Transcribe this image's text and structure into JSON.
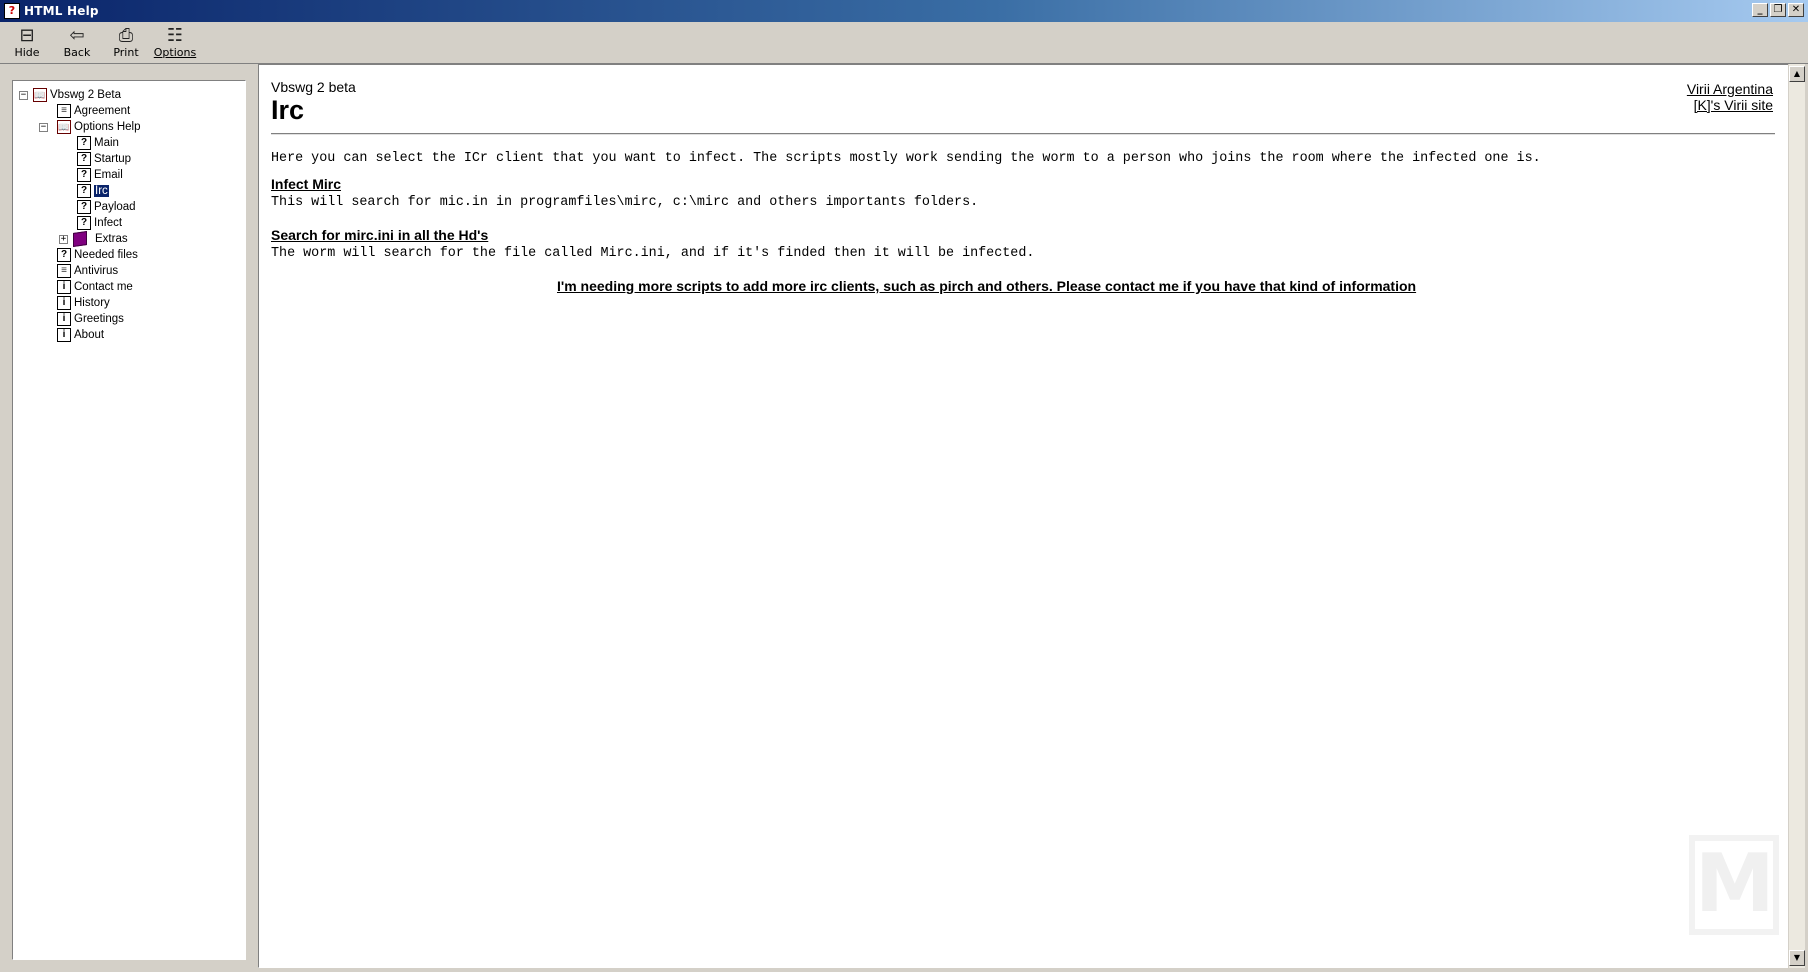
{
  "window": {
    "title": "HTML Help",
    "icon": "help-book-icon"
  },
  "toolbar": {
    "hide_label": "Hide",
    "back_label": "Back",
    "print_label": "Print",
    "options_label": "Options"
  },
  "tree": {
    "root": "Vbswg 2 Beta",
    "agreement": "Agreement",
    "options_help": "Options Help",
    "main": "Main",
    "startup": "Startup",
    "email": "Email",
    "irc": "Irc",
    "payload": "Payload",
    "infect": "Infect",
    "extras": "Extras",
    "needed_files": "Needed files",
    "antivirus": "Antivirus",
    "contact_me": "Contact me",
    "history": "History",
    "greetings": "Greetings",
    "about": "About"
  },
  "content": {
    "header_small": "Vbswg 2 beta",
    "title": "Irc",
    "link_virii_argentina": "Virii Argentina",
    "link_k_virii_site": "[K]'s Virii site",
    "intro": "Here you can select the ICr client that you want to infect. The scripts mostly work sending the worm to a person who joins the room where the infected one is.",
    "section1_title": "Infect Mirc",
    "section1_text": "This will search for mic.in in programfiles\\mirc, c:\\mirc and others importants folders.",
    "section2_title": "Search for mirc.ini in all the Hd's",
    "section2_text": "The worm will search for the file called Mirc.ini, and if it's finded then it will be infected.",
    "note": "I'm needing more scripts to add more irc clients, such as pirch and others. Please contact me if you have that kind of information"
  },
  "colors": {
    "titlebar": "#0a246a",
    "selection": "#0a246a",
    "chrome": "#d4d0c8"
  }
}
